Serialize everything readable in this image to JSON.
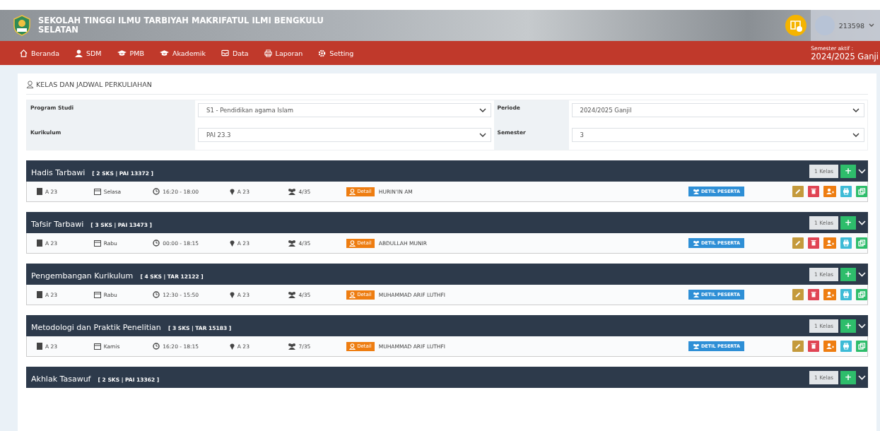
{
  "header": {
    "title_lines": [
      "SEKOLAH TINGGI ILMU TARBIYAH MAKRIFATUL ILMI BENGKULU",
      "SELATAN"
    ],
    "user_id": "213598"
  },
  "nav": {
    "items": [
      {
        "label": "Beranda"
      },
      {
        "label": "SDM"
      },
      {
        "label": "PMB"
      },
      {
        "label": "Akademik"
      },
      {
        "label": "Data"
      },
      {
        "label": "Laporan"
      },
      {
        "label": "Setting"
      }
    ],
    "semester_label": "Semester aktif :",
    "semester_value": "2024/2025 Ganji"
  },
  "page_title": "KELAS DAN JADWAL PERKULIAHAN",
  "filters": [
    {
      "label": "Program Studi",
      "value": "S1 - Pendidikan agama Islam"
    },
    {
      "label": "Periode",
      "value": "2024/2025 Ganjil"
    },
    {
      "label": "Kurikulum",
      "value": "PAI 23.3"
    },
    {
      "label": "Semester",
      "value": "3"
    }
  ],
  "courses": [
    {
      "name": "Hadis Tarbawi",
      "meta": "[ 2 SKS | PAI 13372 ]",
      "kelas": "1 Kelas",
      "plus": "+",
      "classes": [
        {
          "room": "A 23",
          "day": "Selasa",
          "time": "16:20 - 18:00",
          "location": "A 23",
          "participants": "4/35",
          "detail": "Detail",
          "lecturer": "HURIN'IN AM",
          "peserta": "DETIL PESERTA"
        }
      ]
    },
    {
      "name": "Tafsir Tarbawi",
      "meta": "[ 3 SKS | PAI 13473 ]",
      "kelas": "1 Kelas",
      "plus": "+",
      "classes": [
        {
          "room": "A 23",
          "day": "Rabu",
          "time": "00:00 - 18:15",
          "location": "A 23",
          "participants": "4/35",
          "detail": "Detail",
          "lecturer": "ABDULLAH MUNIR",
          "peserta": "DETIL PESERTA"
        }
      ]
    },
    {
      "name": "Pengembangan Kurikulum",
      "meta": "[ 4 SKS | TAR 12122 ]",
      "kelas": "1 Kelas",
      "plus": "+",
      "classes": [
        {
          "room": "A 23",
          "day": "Rabu",
          "time": "12:30 - 15:50",
          "location": "A 23",
          "participants": "4/35",
          "detail": "Detail",
          "lecturer": "MUHAMMAD ARIF LUTHFI",
          "peserta": "DETIL PESERTA"
        }
      ]
    },
    {
      "name": "Metodologi dan Praktik Penelitian",
      "meta": "[ 3 SKS | TAR 15183 ]",
      "kelas": "1 Kelas",
      "plus": "+",
      "classes": [
        {
          "room": "A 23",
          "day": "Kamis",
          "time": "16:20 - 18:15",
          "location": "A 23",
          "participants": "7/35",
          "detail": "Detail",
          "lecturer": "MUHAMMAD ARIF LUTHFI",
          "peserta": "DETIL PESERTA"
        }
      ]
    },
    {
      "name": "Akhlak Tasawuf",
      "meta": "[ 2 SKS | PAI 13362 ]",
      "kelas": "1 Kelas",
      "plus": "+"
    }
  ]
}
